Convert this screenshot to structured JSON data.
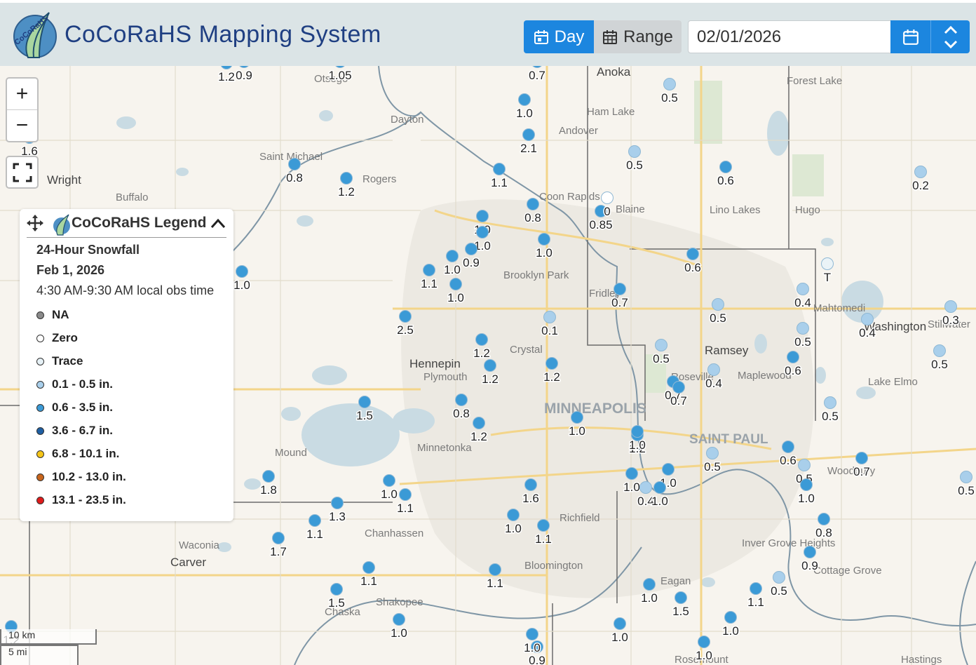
{
  "header": {
    "title": "CoCoRaHS Mapping System",
    "logo_text": "CoCoRaHS",
    "day_label": "Day",
    "range_label": "Range",
    "date_value": "02/01/2026"
  },
  "colors": {
    "header_bg": "#dbe4e6",
    "title": "#1f3f82",
    "active_button": "#1c86df",
    "marker_light": "#a9cfeb",
    "marker_mid": "#3b9ad6",
    "marker_dark": "#1f5fa3"
  },
  "legend": {
    "title": "CoCoRaHS Legend",
    "line1": "24-Hour Snowfall",
    "line2": "Feb 1, 2026",
    "line3": "4:30 AM-9:30 AM local obs time",
    "items": [
      {
        "label": "NA",
        "color": "#8a8a8a"
      },
      {
        "label": "Zero",
        "color": "#ffffff"
      },
      {
        "label": "Trace",
        "color": "#e6f1f6"
      },
      {
        "label": "0.1 - 0.5 in.",
        "color": "#a9cfeb"
      },
      {
        "label": "0.6 - 3.5 in.",
        "color": "#3b9ad6"
      },
      {
        "label": "3.6 - 6.7 in.",
        "color": "#1f5fa3"
      },
      {
        "label": "6.8 - 10.1 in.",
        "color": "#f5c518"
      },
      {
        "label": "10.2 - 13.0 in.",
        "color": "#c8651c"
      },
      {
        "label": "13.1 - 23.5 in.",
        "color": "#e01b1b"
      }
    ]
  },
  "scale": {
    "km": "10 km",
    "mi": "5 mi"
  },
  "places": [
    "Otsego",
    "Anoka",
    "Forest Lake",
    "Dayton",
    "Ham Lake",
    "Andover",
    "Saint Michael",
    "Rogers",
    "Wright",
    "Buffalo",
    "Coon Rapids",
    "Blaine",
    "Lino Lakes",
    "Hugo",
    "Brooklyn Park",
    "Fridley",
    "Mahtomedi",
    "Washington",
    "Stillwater",
    "Ramsey",
    "Crystal",
    "Hennepin",
    "Plymouth",
    "Roseville",
    "Maplewood",
    "Lake Elmo",
    "MINNEAPOLIS",
    "SAINT PAUL",
    "Mound",
    "Minnetonka",
    "Woodbury",
    "Richfield",
    "Chanhassen",
    "Waconia",
    "Carver",
    "Inver Grove Heights",
    "Bloomington",
    "Cottage Grove",
    "Eagan",
    "Shakopee",
    "Chaska",
    "Hastings",
    "Rosemount"
  ],
  "stations": [
    "1.2",
    "0.9",
    "1.05",
    "0.7",
    "0.5",
    "1.0",
    "2.1",
    "1.6",
    "0.8",
    "1.2",
    "1.1",
    "0.5",
    "0.6",
    "0.2",
    "1.0",
    "0.8",
    "0.85",
    "0",
    "1.0",
    "1.0",
    "0.9",
    "1.0",
    "1.1",
    "1.0",
    "0.6",
    "1.0",
    "T",
    "0.7",
    "0.4",
    "0.5",
    "0.4",
    "0.3",
    "2.5",
    "0.1",
    "1.2",
    "0.5",
    "0.5",
    "1.2",
    "1.2",
    "0.6",
    "0.7",
    "0.4",
    "0.7",
    "0.5",
    "1.5",
    "0.8",
    "1.2",
    "1.0",
    "1.2",
    "0.5",
    "0.6",
    "0.5",
    "0.7",
    "0.5",
    "1.0",
    "1.8",
    "1.0",
    "1.1",
    "1.6",
    "1.0",
    "1.0",
    "0.4",
    "1.0",
    "1.3",
    "1.1",
    "1.0",
    "1.1",
    "0.8",
    "1.7",
    "0.9",
    "1.1",
    "1.1",
    "1.5",
    "1.0",
    "1.5",
    "1.1",
    "0.5",
    "1.0",
    "1.0",
    "1.0",
    "0.5",
    "0.9",
    "1.0",
    "1.2",
    "1.0",
    "1.0"
  ]
}
